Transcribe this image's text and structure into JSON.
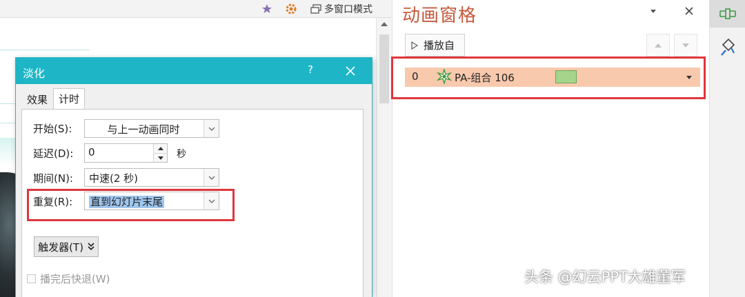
{
  "toolbar": {
    "multi_window_label": "多窗口模式"
  },
  "dialog": {
    "title": "淡化",
    "help_label": "?",
    "tabs": [
      {
        "label": "效果"
      },
      {
        "label": "计时"
      }
    ],
    "fields": {
      "start_label": "开始(S):",
      "start_value": "与上一动画同时",
      "delay_label": "延迟(D):",
      "delay_value": "0",
      "delay_unit": "秒",
      "duration_label": "期间(N):",
      "duration_value": "中速(2 秒)",
      "repeat_label": "重复(R):",
      "repeat_value": "直到幻灯片末尾",
      "rewind_label": "播完后快退(W)"
    },
    "trigger_label": "触发器(T)"
  },
  "animation_pane": {
    "title": "动画窗格",
    "play_label": "播放自",
    "items": [
      {
        "index": "0",
        "name": "PA-组合 106"
      }
    ]
  },
  "colors": {
    "dialog_titlebar": "#1eb6c6",
    "pane_title": "#c55a3d",
    "item_highlight": "#f8c9ad",
    "timeline_bar": "#a5d58a",
    "annotation_red": "#e0353b"
  },
  "watermark": "头条 @幻云PPT大雄董军"
}
